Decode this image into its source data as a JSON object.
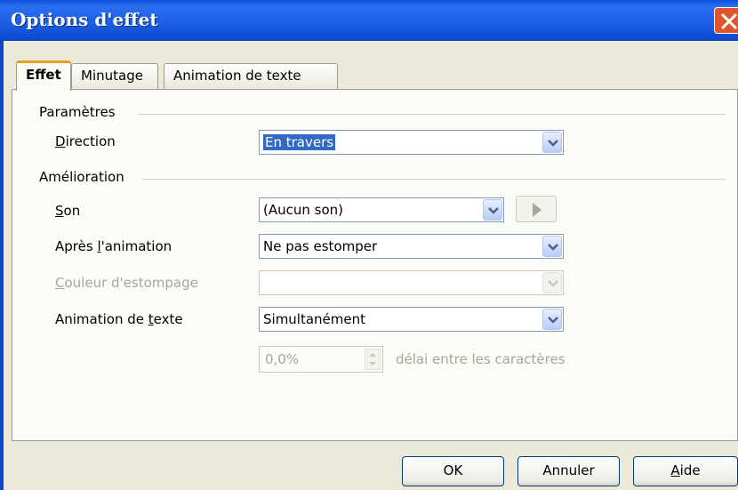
{
  "window": {
    "title": "Options d'effet"
  },
  "tabs": [
    {
      "label": "Effet",
      "active": true
    },
    {
      "label": "Minutage"
    },
    {
      "label": "Animation de texte"
    }
  ],
  "parametres": {
    "heading": "Paramètres",
    "direction": {
      "label": "Direction",
      "value": "En travers"
    }
  },
  "amelioration": {
    "heading": "Amélioration",
    "son": {
      "label": "Son",
      "value": "(Aucun son)"
    },
    "apres": {
      "label": "Après l'animation",
      "value": "Ne pas estomper"
    },
    "couleur": {
      "label": "Couleur d'estompage",
      "value": ""
    },
    "animation_texte": {
      "label": "Animation de texte",
      "value": "Simultanément"
    },
    "delai": {
      "value": "0,0%",
      "suffix": "délai entre les caractères"
    }
  },
  "buttons": {
    "ok": "OK",
    "cancel": "Annuler",
    "help": "Aide"
  }
}
